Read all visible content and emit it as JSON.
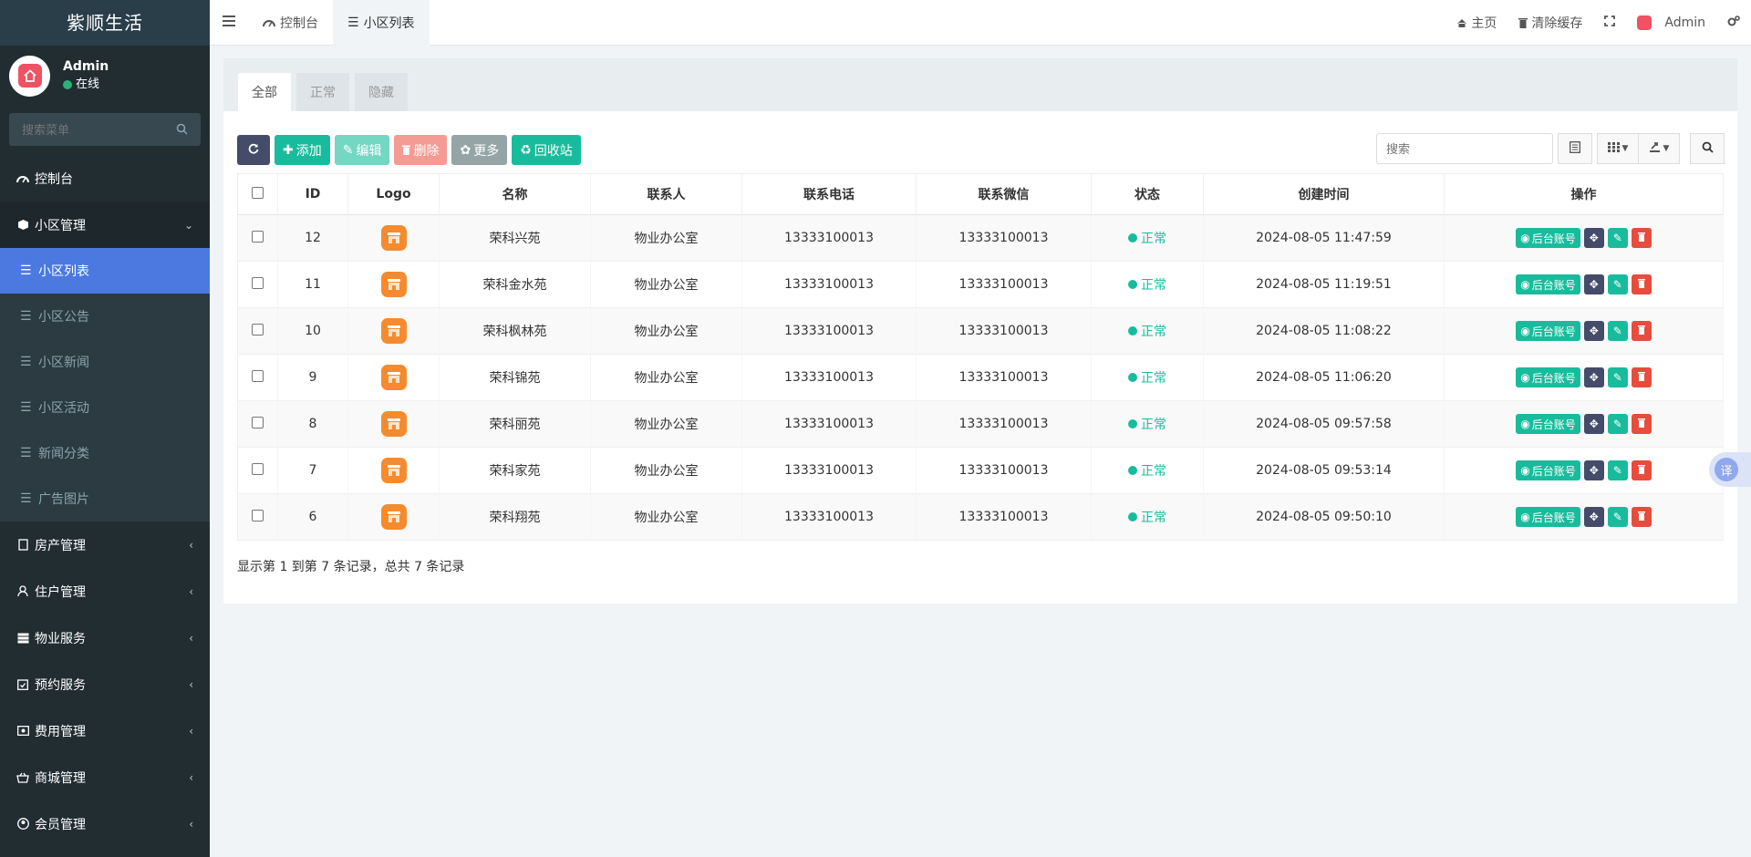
{
  "app": {
    "title": "紫顺生活"
  },
  "user": {
    "name": "Admin",
    "status": "在线"
  },
  "sidebar": {
    "search_placeholder": "搜索菜单",
    "dashboard": "控制台",
    "community": {
      "label": "小区管理",
      "items": [
        "小区列表",
        "小区公告",
        "小区新闻",
        "小区活动",
        "新闻分类",
        "广告图片"
      ]
    },
    "groups": [
      "房产管理",
      "住户管理",
      "物业服务",
      "预约服务",
      "费用管理",
      "商城管理",
      "会员管理"
    ]
  },
  "header": {
    "tabs": [
      "控制台",
      "小区列表"
    ],
    "home": "主页",
    "clear_cache": "清除缓存",
    "user": "Admin"
  },
  "panel": {
    "tabs": [
      "全部",
      "正常",
      "隐藏"
    ],
    "toolbar": {
      "add": "添加",
      "edit": "编辑",
      "delete": "删除",
      "more": "更多",
      "recycle": "回收站"
    },
    "search_placeholder": "搜索",
    "columns": [
      "ID",
      "Logo",
      "名称",
      "联系人",
      "联系电话",
      "联系微信",
      "状态",
      "创建时间",
      "操作"
    ],
    "account_btn": "后台账号",
    "rows": [
      {
        "id": "12",
        "name": "荣科兴苑",
        "contact": "物业办公室",
        "phone": "13333100013",
        "wechat": "13333100013",
        "status": "正常",
        "created": "2024-08-05 11:47:59"
      },
      {
        "id": "11",
        "name": "荣科金水苑",
        "contact": "物业办公室",
        "phone": "13333100013",
        "wechat": "13333100013",
        "status": "正常",
        "created": "2024-08-05 11:19:51"
      },
      {
        "id": "10",
        "name": "荣科枫林苑",
        "contact": "物业办公室",
        "phone": "13333100013",
        "wechat": "13333100013",
        "status": "正常",
        "created": "2024-08-05 11:08:22"
      },
      {
        "id": "9",
        "name": "荣科锦苑",
        "contact": "物业办公室",
        "phone": "13333100013",
        "wechat": "13333100013",
        "status": "正常",
        "created": "2024-08-05 11:06:20"
      },
      {
        "id": "8",
        "name": "荣科丽苑",
        "contact": "物业办公室",
        "phone": "13333100013",
        "wechat": "13333100013",
        "status": "正常",
        "created": "2024-08-05 09:57:58"
      },
      {
        "id": "7",
        "name": "荣科家苑",
        "contact": "物业办公室",
        "phone": "13333100013",
        "wechat": "13333100013",
        "status": "正常",
        "created": "2024-08-05 09:53:14"
      },
      {
        "id": "6",
        "name": "荣科翔苑",
        "contact": "物业办公室",
        "phone": "13333100013",
        "wechat": "13333100013",
        "status": "正常",
        "created": "2024-08-05 09:50:10"
      }
    ],
    "summary": "显示第 1 到第 7 条记录，总共 7 条记录"
  },
  "translate_label": "译",
  "colors": {
    "sidebar": "#222d32",
    "active": "#4b79e0",
    "success": "#18bc9c",
    "danger": "#e74c3c"
  }
}
